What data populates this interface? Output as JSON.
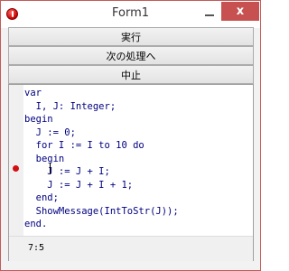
{
  "window": {
    "title": "Form1",
    "close_glyph": "x"
  },
  "buttons": {
    "run": "実行",
    "next": "次の処理へ",
    "stop": "中止"
  },
  "editor": {
    "lines": [
      "var",
      "  I, J: Integer;",
      "begin",
      "  J := 0;",
      "  for I := I to 10 do",
      "  begin",
      "    J := J + I;",
      "    J := J + I + 1;",
      "  end;",
      "  ShowMessage(IntToStr(J));",
      "end."
    ],
    "breakpoint_line": 7,
    "cursor_position": "7:5"
  },
  "icons": {
    "app": "app-icon",
    "minimize": "minimize-icon",
    "close": "close-icon",
    "breakpoint": "breakpoint-icon"
  }
}
